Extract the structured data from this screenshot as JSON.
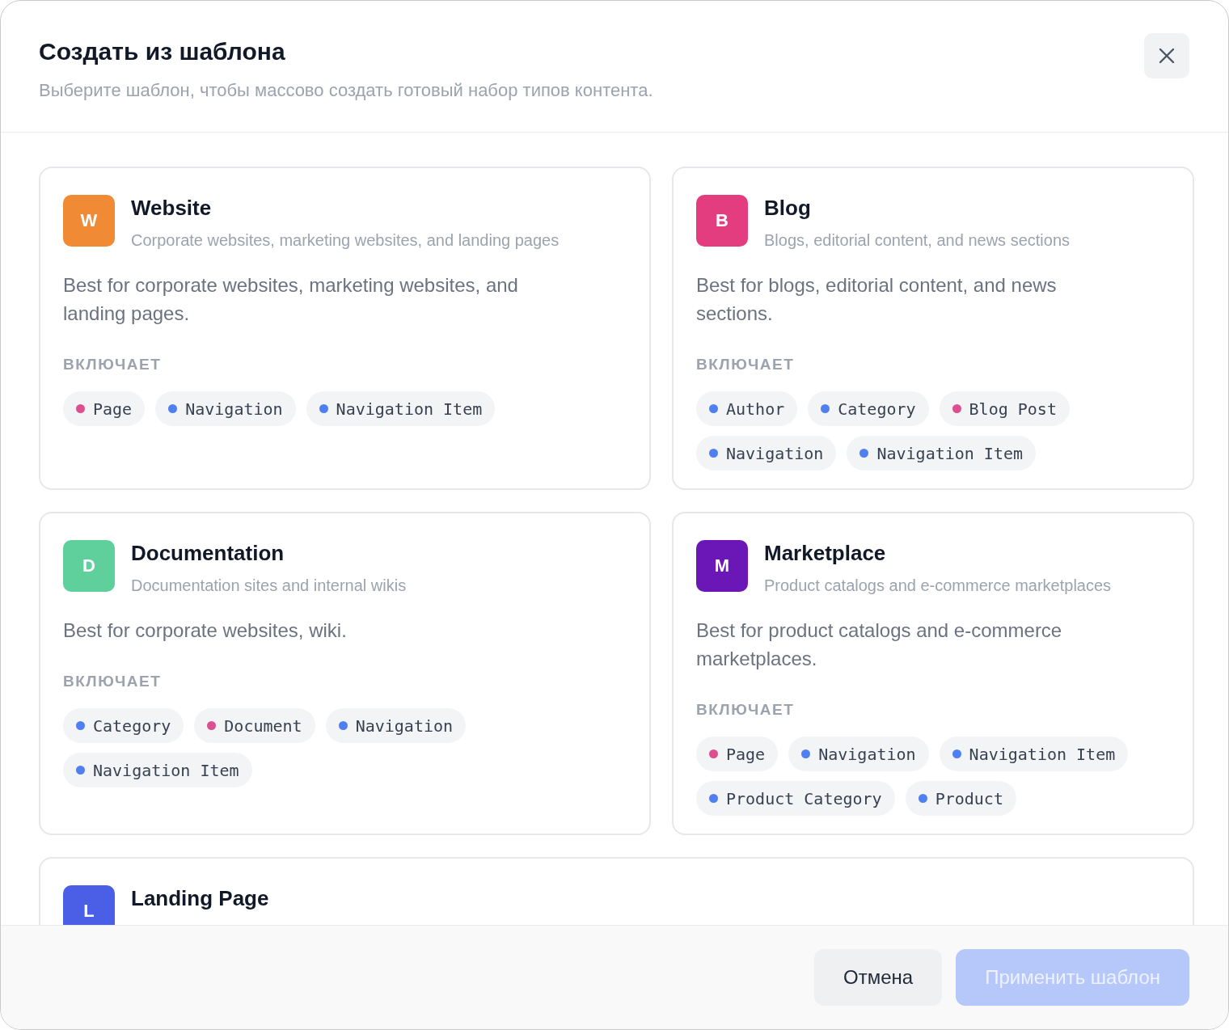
{
  "dialog": {
    "title": "Создать из шаблона",
    "subtitle": "Выберите шаблон, чтобы массово создать готовый набор типов контента."
  },
  "templates": [
    {
      "letter": "W",
      "color": "#f08a34",
      "name": "Website",
      "summary": "Corporate websites, marketing websites, and landing pages",
      "description": "Best for corporate websites, marketing websites, and landing pages.",
      "includes_label": "ВКЛЮЧАЕТ",
      "types": [
        {
          "label": "Page",
          "color": "#dd4f8f"
        },
        {
          "label": "Navigation",
          "color": "#4f7ff0"
        },
        {
          "label": "Navigation Item",
          "color": "#4f7ff0"
        }
      ]
    },
    {
      "letter": "B",
      "color": "#e33d7f",
      "name": "Blog",
      "summary": "Blogs, editorial content, and news sections",
      "description": "Best for blogs, editorial content, and news sections.",
      "includes_label": "ВКЛЮЧАЕТ",
      "types": [
        {
          "label": "Author",
          "color": "#4f7ff0"
        },
        {
          "label": "Category",
          "color": "#4f7ff0"
        },
        {
          "label": "Blog Post",
          "color": "#dd4f8f"
        },
        {
          "label": "Navigation",
          "color": "#4f7ff0"
        },
        {
          "label": "Navigation Item",
          "color": "#4f7ff0"
        }
      ]
    },
    {
      "letter": "D",
      "color": "#5fcf9c",
      "name": "Documentation",
      "summary": "Documentation sites and internal wikis",
      "description": "Best for corporate websites, wiki.",
      "includes_label": "ВКЛЮЧАЕТ",
      "types": [
        {
          "label": "Category",
          "color": "#4f7ff0"
        },
        {
          "label": "Document",
          "color": "#dd4f8f"
        },
        {
          "label": "Navigation",
          "color": "#4f7ff0"
        },
        {
          "label": "Navigation Item",
          "color": "#4f7ff0"
        }
      ]
    },
    {
      "letter": "M",
      "color": "#6b17b8",
      "name": "Marketplace",
      "summary": "Product catalogs and e-commerce marketplaces",
      "description": "Best for product catalogs and e-commerce marketplaces.",
      "includes_label": "ВКЛЮЧАЕТ",
      "types": [
        {
          "label": "Page",
          "color": "#dd4f8f"
        },
        {
          "label": "Navigation",
          "color": "#4f7ff0"
        },
        {
          "label": "Navigation Item",
          "color": "#4f7ff0"
        },
        {
          "label": "Product Category",
          "color": "#4f7ff0"
        },
        {
          "label": "Product",
          "color": "#4f7ff0"
        }
      ]
    },
    {
      "letter": "L",
      "color": "#4a5ee6",
      "name": "Landing Page"
    }
  ],
  "footer": {
    "cancel": "Отмена",
    "apply": {
      "label": "Применить шаблон",
      "disabled": true
    }
  }
}
